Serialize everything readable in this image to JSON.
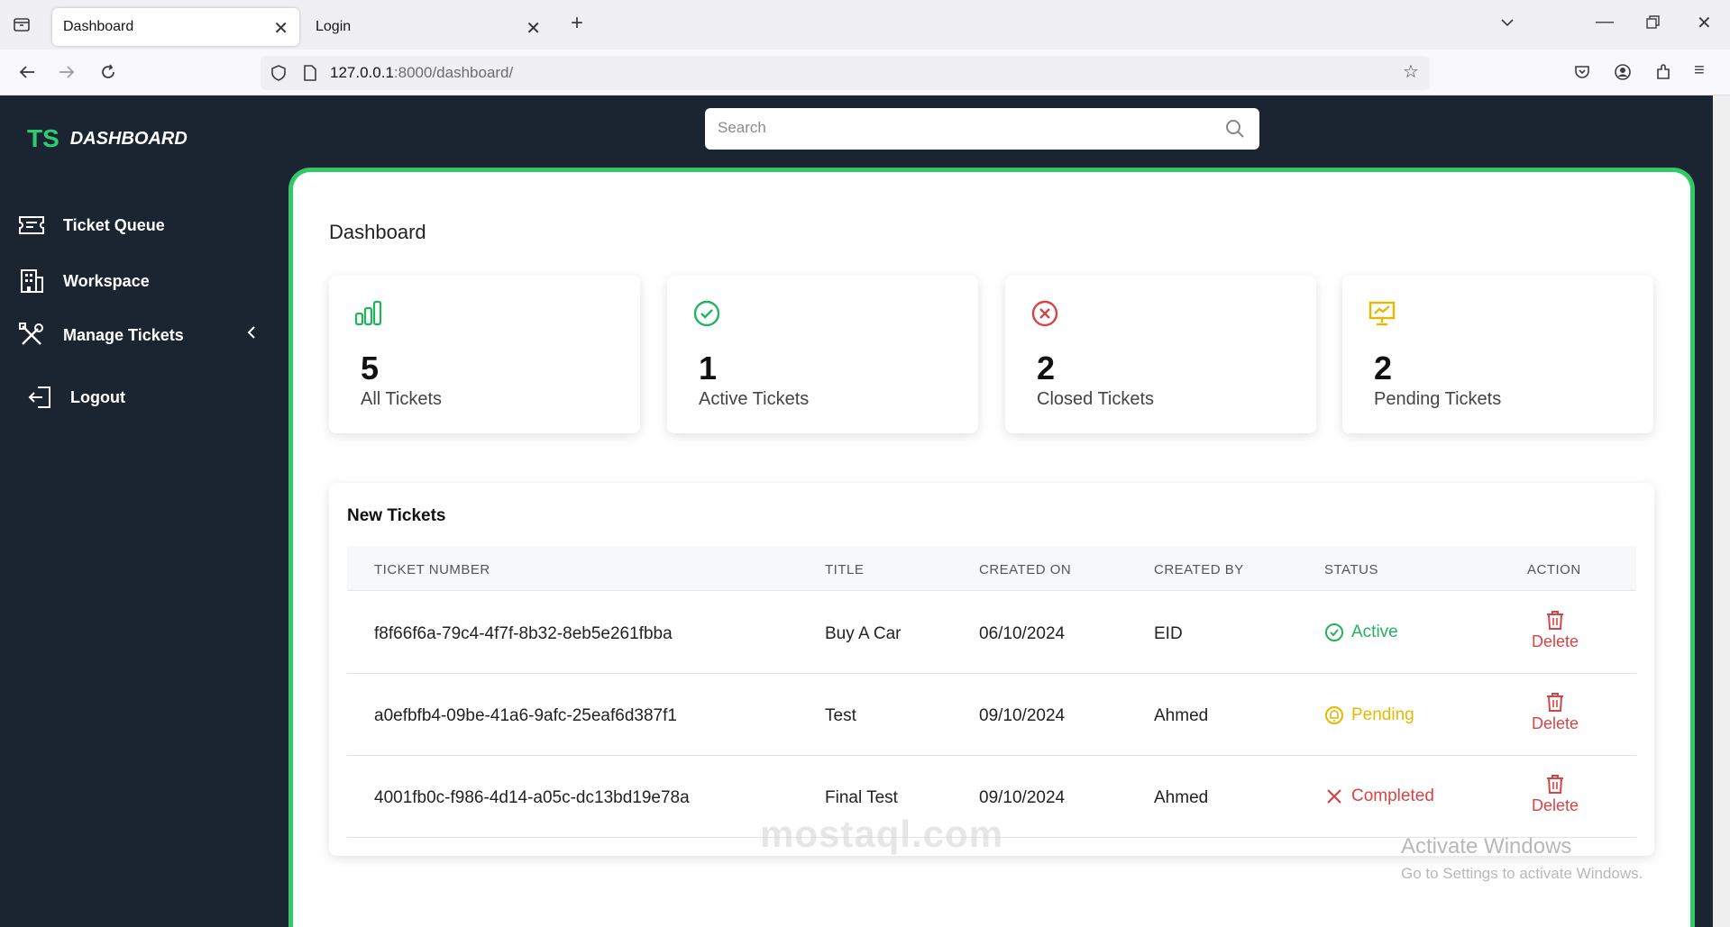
{
  "browser": {
    "tabs": [
      {
        "label": "Dashboard"
      },
      {
        "label": "Login"
      }
    ],
    "url_host": "127.0.0.1",
    "url_rest": ":8000/dashboard/"
  },
  "brand": {
    "short": "TS",
    "name": "DASHBOARD"
  },
  "sidebar": {
    "items": [
      {
        "label": "Ticket Queue"
      },
      {
        "label": "Workspace"
      },
      {
        "label": "Manage Tickets"
      },
      {
        "label": "Logout"
      }
    ]
  },
  "search": {
    "placeholder": "Search"
  },
  "page": {
    "title": "Dashboard"
  },
  "stats": [
    {
      "value": "5",
      "label": "All Tickets",
      "color": "#22b35e",
      "icon": "bar-chart-icon"
    },
    {
      "value": "1",
      "label": "Active Tickets",
      "color": "#22b35e",
      "icon": "check-circle-icon"
    },
    {
      "value": "2",
      "label": "Closed Tickets",
      "color": "#d64545",
      "icon": "x-circle-icon"
    },
    {
      "value": "2",
      "label": "Pending Tickets",
      "color": "#e6b800",
      "icon": "presentation-chart-icon"
    }
  ],
  "tickets": {
    "title": "New Tickets",
    "columns": [
      "TICKET NUMBER",
      "TITLE",
      "CREATED ON",
      "CREATED BY",
      "STATUS",
      "ACTION"
    ],
    "rows": [
      {
        "number": "f8f66f6a-79c4-4f7f-8b32-8eb5e261fbba",
        "title": "Buy A Car",
        "created_on": "06/10/2024",
        "created_by": "EID",
        "status": "Active",
        "action": "Delete"
      },
      {
        "number": "a0efbfb4-09be-41a6-9afc-25eaf6d387f1",
        "title": "Test",
        "created_on": "09/10/2024",
        "created_by": "Ahmed",
        "status": "Pending",
        "action": "Delete"
      },
      {
        "number": "4001fb0c-f986-4d14-a05c-dc13bd19e78a",
        "title": "Final Test",
        "created_on": "09/10/2024",
        "created_by": "Ahmed",
        "status": "Completed",
        "action": "Delete"
      }
    ]
  },
  "status_colors": {
    "active": "#22b35e",
    "pending": "#e6b800",
    "completed": "#d64545"
  },
  "watermark": {
    "line1": "Activate Windows",
    "line2": "Go to Settings to activate Windows.",
    "site": "mostaql.com"
  }
}
